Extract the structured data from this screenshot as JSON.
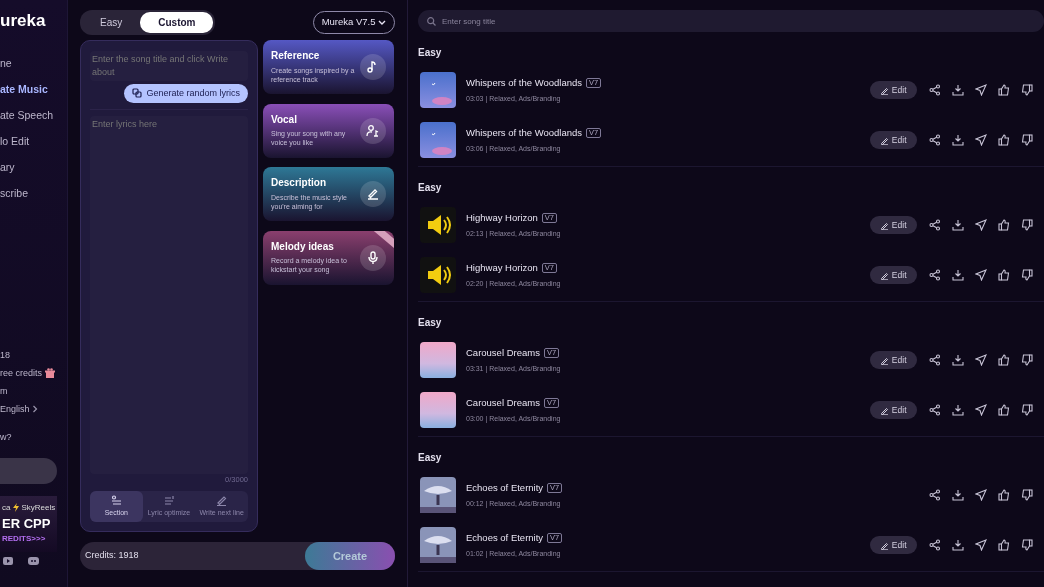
{
  "sidebar": {
    "logo": "ureka",
    "nav": [
      {
        "label": "ne",
        "selected": false
      },
      {
        "label": "ate Music",
        "selected": true
      },
      {
        "label": "ate Speech",
        "selected": false
      },
      {
        "label": "lo Edit",
        "selected": false
      },
      {
        "label": "ary",
        "selected": false
      },
      {
        "label": "scribe",
        "selected": false
      }
    ],
    "account_lines": [
      {
        "text": "18",
        "kind": "plain"
      },
      {
        "text": "ree credits",
        "kind": "gift"
      },
      {
        "text": "m",
        "kind": "plain"
      },
      {
        "text": "English",
        "kind": "chevron"
      }
    ],
    "question": "w?",
    "banner": {
      "brand_left": "ca",
      "brand_right": "SkyReels",
      "headline": "ER CPP",
      "subline": "REDITS>>>"
    }
  },
  "mode_tabs": [
    {
      "label": "Easy",
      "selected": false
    },
    {
      "label": "Custom",
      "selected": true
    }
  ],
  "model_select": {
    "value": "Mureka V7.5"
  },
  "lyrics": {
    "title_placeholder": "Enter the song title and click Write about",
    "generate_button": "Generate random lyrics",
    "lyrics_placeholder": "Enter lyrics here",
    "counter": "0/3000",
    "tools": [
      {
        "label": "Section",
        "selected": true,
        "kind": "section"
      },
      {
        "label": "Lyric optimize",
        "selected": false,
        "kind": "optimize"
      },
      {
        "label": "Write next line",
        "selected": false,
        "kind": "pen"
      }
    ]
  },
  "features": [
    {
      "title": "Reference",
      "description": "Create songs inspired by a reference track",
      "color": "#5558c4",
      "kind": "note",
      "ribbon": false
    },
    {
      "title": "Vocal",
      "description": "Sing your song with any voice you like",
      "color": "#8a4fb8",
      "kind": "voice",
      "ribbon": false
    },
    {
      "title": "Description",
      "description": "Describe the music style you're aiming for",
      "color": "#2e7896",
      "kind": "pen",
      "ribbon": false
    },
    {
      "title": "Melody ideas",
      "description": "Record a melody idea to kickstart your song",
      "color": "#8a3f6e",
      "kind": "mic",
      "ribbon": true
    }
  ],
  "credits": {
    "text": "Credits: 1918",
    "create_button": "Create",
    "disabled": true
  },
  "search": {
    "placeholder": "Enter song title"
  },
  "groups": [
    {
      "heading": "Easy",
      "songs": [
        {
          "title": "Whispers of the Woodlands",
          "version": "V7",
          "meta": "03:03 | Relaxed, Ads/Branding",
          "kind": "sky",
          "editable": true,
          "edit_label": "Edit"
        },
        {
          "title": "Whispers of the Woodlands",
          "version": "V7",
          "meta": "03:06 | Relaxed, Ads/Branding",
          "kind": "sky",
          "editable": true,
          "edit_label": "Edit"
        }
      ]
    },
    {
      "heading": "Easy",
      "songs": [
        {
          "title": "Highway Horizon",
          "version": "V7",
          "meta": "02:13 | Relaxed, Ads/Branding",
          "kind": "speaker",
          "editable": true,
          "edit_label": "Edit"
        },
        {
          "title": "Highway Horizon",
          "version": "V7",
          "meta": "02:20 | Relaxed, Ads/Branding",
          "kind": "speaker",
          "editable": true,
          "edit_label": "Edit"
        }
      ]
    },
    {
      "heading": "Easy",
      "songs": [
        {
          "title": "Carousel Dreams",
          "version": "V7",
          "meta": "03:31 | Relaxed, Ads/Branding",
          "kind": "pink",
          "editable": true,
          "edit_label": "Edit"
        },
        {
          "title": "Carousel Dreams",
          "version": "V7",
          "meta": "03:00 | Relaxed, Ads/Branding",
          "kind": "pink",
          "editable": true,
          "edit_label": "Edit"
        }
      ]
    },
    {
      "heading": "Easy",
      "songs": [
        {
          "title": "Echoes of Eternity",
          "version": "V7",
          "meta": "00:12 | Relaxed, Ads/Branding",
          "kind": "figure",
          "editable": false
        },
        {
          "title": "Echoes of Eternity",
          "version": "V7",
          "meta": "01:02 | Relaxed, Ads/Branding",
          "kind": "figure",
          "editable": true,
          "edit_label": "Edit"
        }
      ]
    }
  ]
}
